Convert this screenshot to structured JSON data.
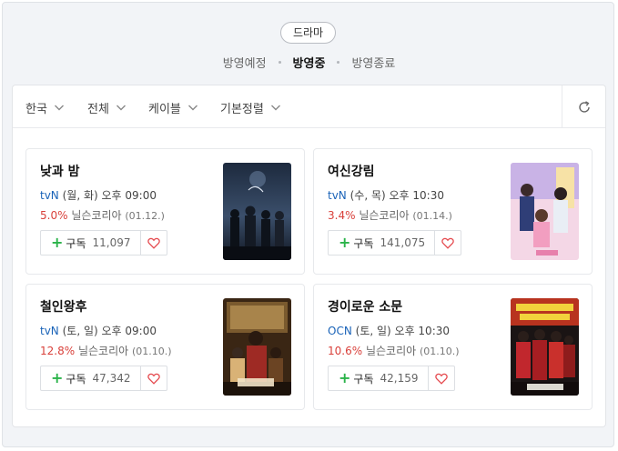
{
  "header": {
    "genre": "드라마",
    "tabs": [
      {
        "label": "방영예정",
        "active": false
      },
      {
        "label": "방영중",
        "active": true
      },
      {
        "label": "방영종료",
        "active": false
      }
    ]
  },
  "filters": [
    {
      "label": "한국"
    },
    {
      "label": "전체"
    },
    {
      "label": "케이블"
    },
    {
      "label": "기본정렬"
    }
  ],
  "icons": {
    "refresh": "refresh-icon",
    "heart": "heart-icon",
    "plus": "plus-icon",
    "chevron": "chevron-down-icon"
  },
  "colors": {
    "channel": "#1a63b8",
    "rating": "#d9413b",
    "plus": "#2bb34a",
    "heart": "#e5494e"
  },
  "dramas": [
    {
      "title": "낮과 밤",
      "channel": "tvN",
      "schedule": "(월, 화) 오후 09:00",
      "rating": "5.0%",
      "source": "닐슨코리아",
      "date": "(01.12.)",
      "subscribe_label": "구독",
      "subscribers": "11,097"
    },
    {
      "title": "여신강림",
      "channel": "tvN",
      "schedule": "(수, 목) 오후 10:30",
      "rating": "3.4%",
      "source": "닐슨코리아",
      "date": "(01.14.)",
      "subscribe_label": "구독",
      "subscribers": "141,075"
    },
    {
      "title": "철인왕후",
      "channel": "tvN",
      "schedule": "(토, 일) 오후 09:00",
      "rating": "12.8%",
      "source": "닐슨코리아",
      "date": "(01.10.)",
      "subscribe_label": "구독",
      "subscribers": "47,342"
    },
    {
      "title": "경이로운 소문",
      "channel": "OCN",
      "schedule": "(토, 일) 오후 10:30",
      "rating": "10.6%",
      "source": "닐슨코리아",
      "date": "(01.10.)",
      "subscribe_label": "구독",
      "subscribers": "42,159"
    }
  ]
}
